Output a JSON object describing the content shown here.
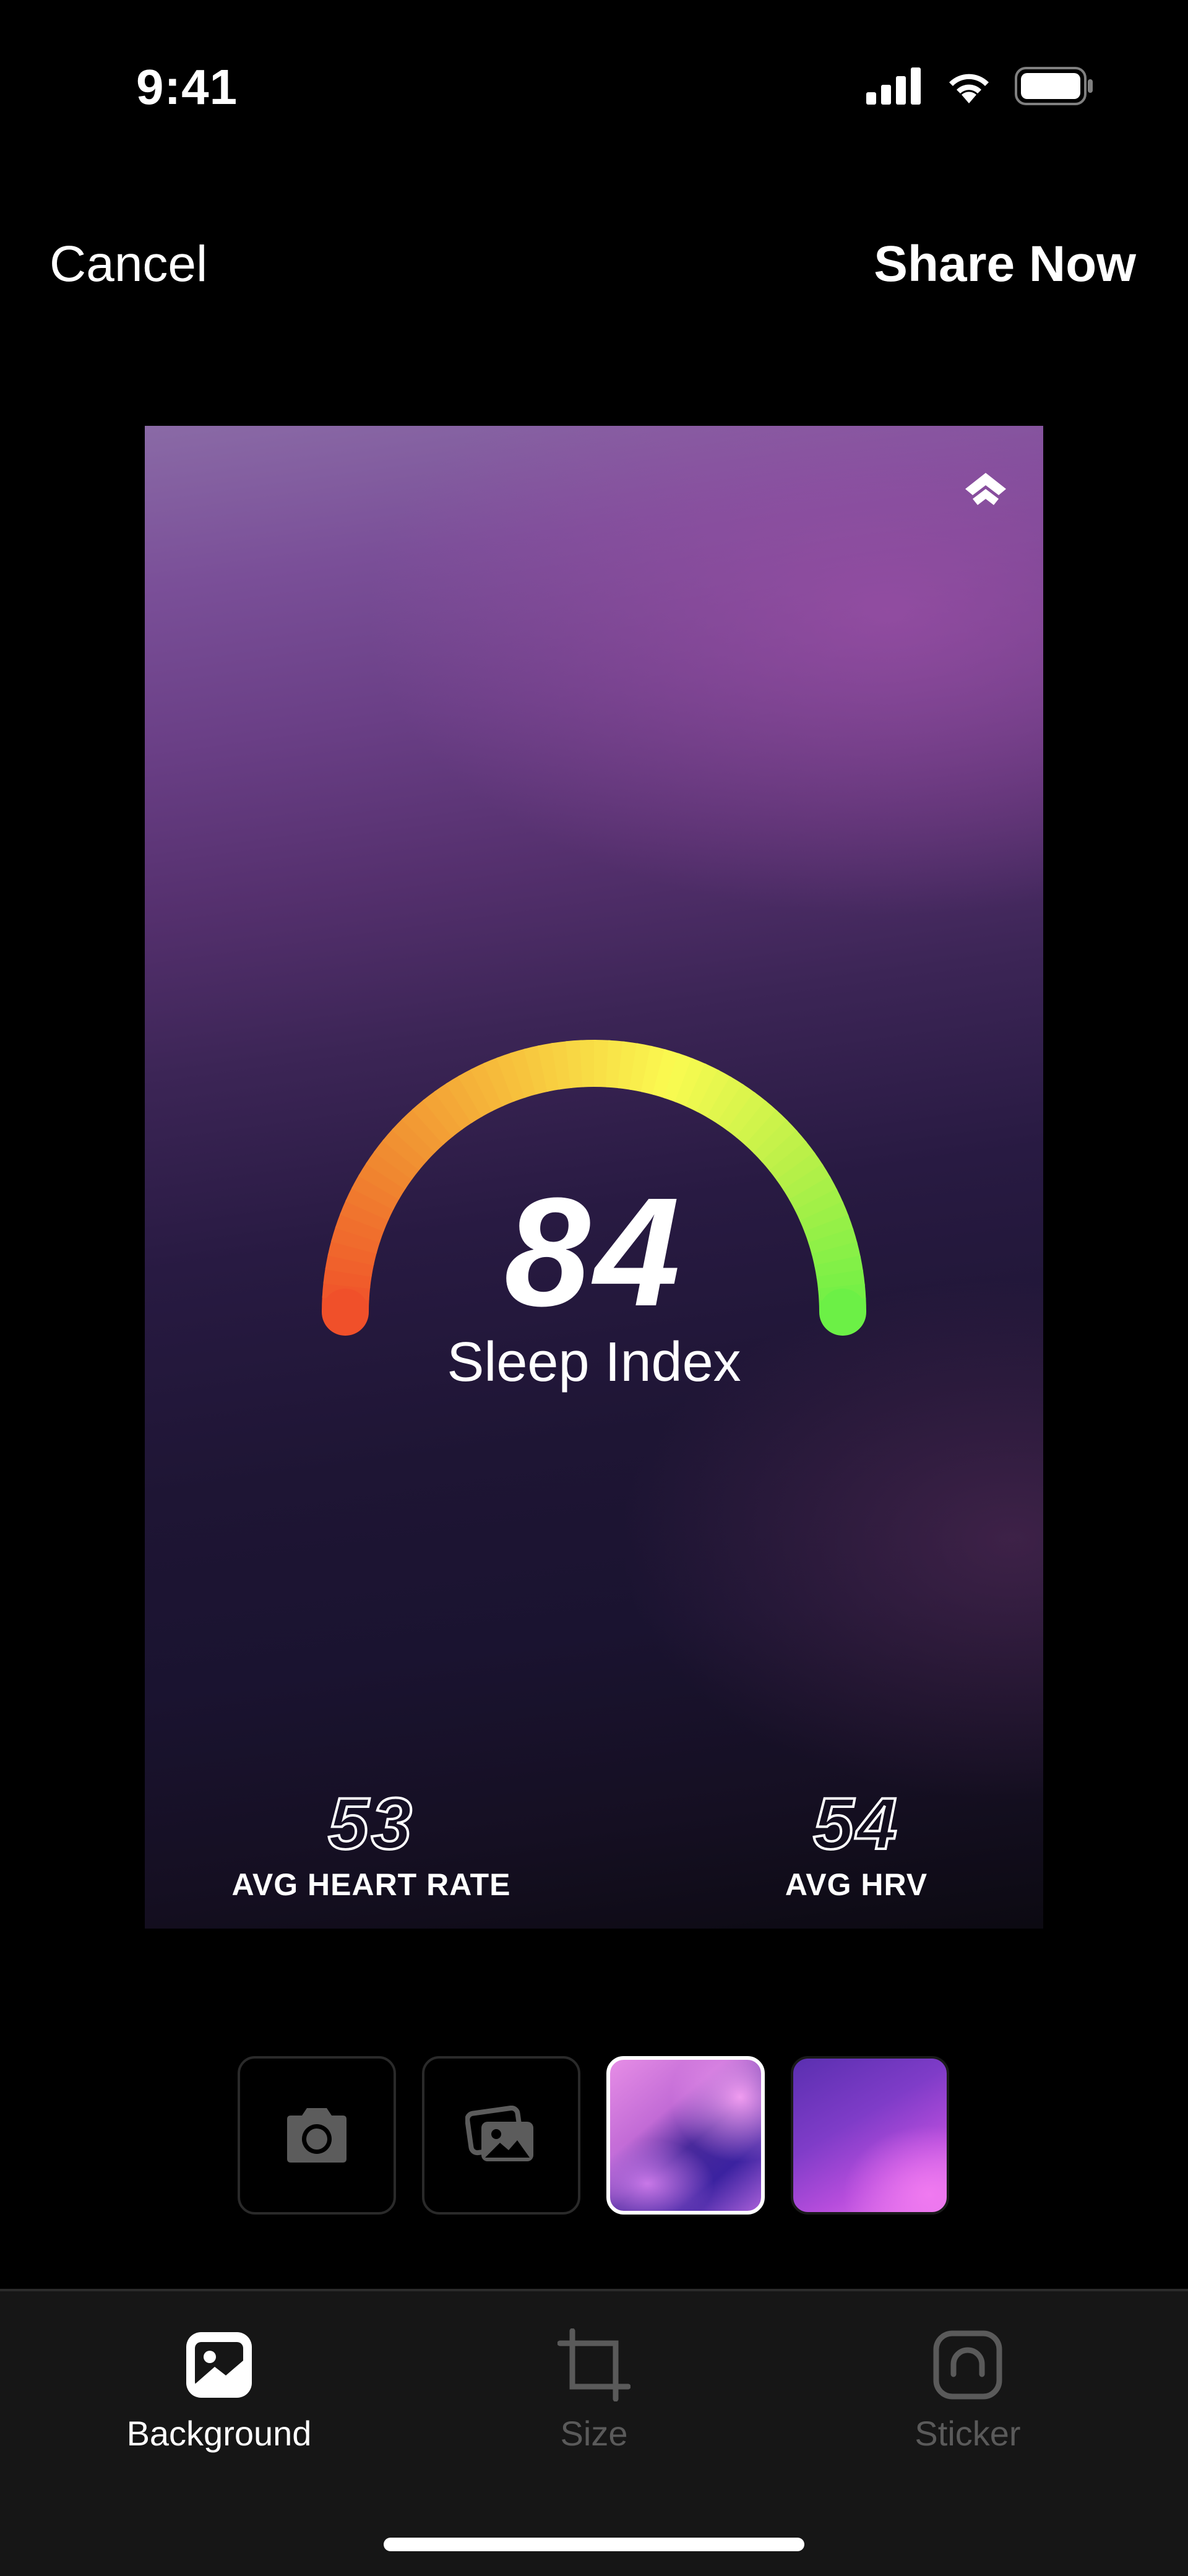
{
  "status_bar": {
    "time": "9:41",
    "icons": [
      "signal-icon",
      "wifi-icon",
      "battery-icon"
    ]
  },
  "nav": {
    "cancel_label": "Cancel",
    "share_label": "Share Now"
  },
  "card": {
    "logo_icon": "brand-chevron-icon",
    "score": {
      "value": "84",
      "label": "Sleep Index",
      "gauge_fill": 1.0,
      "gauge_colors": [
        "#f0502a",
        "#f08a30",
        "#f7c23c",
        "#fafa50",
        "#b8f048",
        "#6cf046"
      ]
    },
    "stats": [
      {
        "value": "53",
        "label": "AVG HEART RATE"
      },
      {
        "value": "54",
        "label": "AVG HRV"
      }
    ]
  },
  "background_picker": {
    "options": [
      {
        "icon": "camera-icon",
        "selected": false
      },
      {
        "icon": "photo-library-icon",
        "selected": false
      },
      {
        "icon": "gradient-swatch-1",
        "selected": true
      },
      {
        "icon": "gradient-swatch-2",
        "selected": false
      }
    ]
  },
  "tabbar": {
    "tabs": [
      {
        "label": "Background",
        "icon": "image-icon",
        "active": true
      },
      {
        "label": "Size",
        "icon": "crop-icon",
        "active": false
      },
      {
        "label": "Sticker",
        "icon": "sticker-icon",
        "active": false
      }
    ]
  }
}
